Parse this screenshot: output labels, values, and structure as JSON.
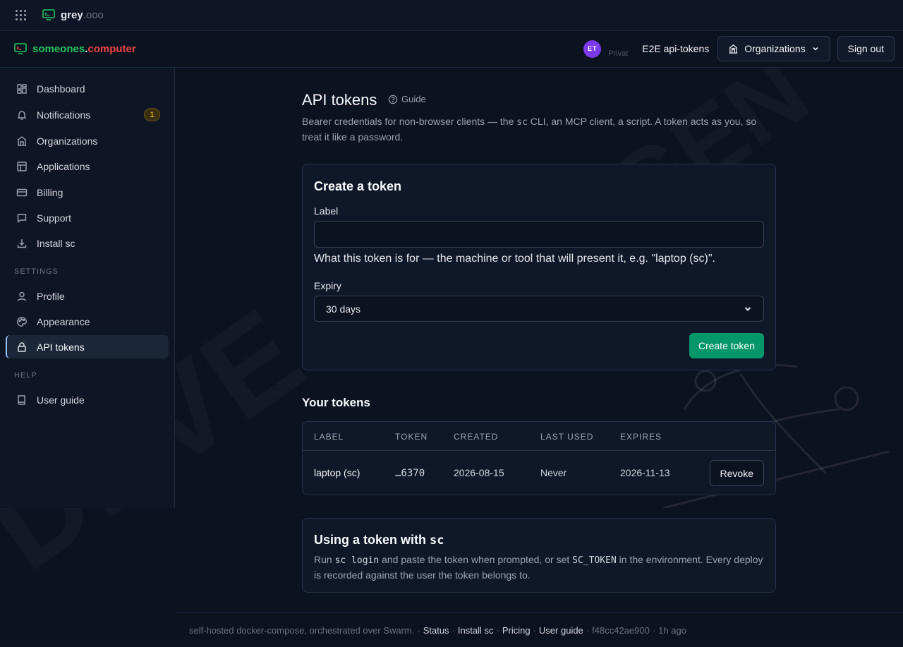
{
  "topbar": {
    "brand_main": "grey",
    "brand_suffix": ".ooo"
  },
  "header": {
    "brand_a": "someones",
    "brand_dot": ".",
    "brand_b": "computer",
    "avatar_initials": "ET",
    "avatar_sub": "Privat",
    "org_name": "E2E api-tokens",
    "organizations_label": "Organizations",
    "sign_out_label": "Sign out"
  },
  "sidebar": {
    "items": [
      {
        "label": "Dashboard",
        "icon": "dashboard-icon"
      },
      {
        "label": "Notifications",
        "icon": "bell-icon",
        "badge": "1"
      },
      {
        "label": "Organizations",
        "icon": "building-icon"
      },
      {
        "label": "Applications",
        "icon": "layout-icon"
      },
      {
        "label": "Billing",
        "icon": "credit-card-icon"
      },
      {
        "label": "Support",
        "icon": "chat-icon"
      },
      {
        "label": "Install sc",
        "icon": "download-icon"
      }
    ],
    "settings_label": "SETTINGS",
    "settings_items": [
      {
        "label": "Profile",
        "icon": "user-icon"
      },
      {
        "label": "Appearance",
        "icon": "palette-icon"
      },
      {
        "label": "API tokens",
        "icon": "lock-icon",
        "active": true
      }
    ],
    "help_label": "HELP",
    "help_items": [
      {
        "label": "User guide",
        "icon": "book-icon"
      }
    ]
  },
  "page": {
    "title": "API tokens",
    "guide_label": "Guide",
    "intro_a": "Bearer credentials for non-browser clients — the ",
    "intro_code": "sc",
    "intro_b": " CLI, an MCP client, a script. A token acts as you, so treat it like a password."
  },
  "create": {
    "title": "Create a token",
    "label_field": "Label",
    "label_value": "",
    "help": "What this token is for — the machine or tool that will present it, e.g. \"laptop (sc)\".",
    "expiry_label": "Expiry",
    "expiry_value": "30 days",
    "submit_label": "Create token"
  },
  "tokens": {
    "title": "Your tokens",
    "columns": [
      "LABEL",
      "TOKEN",
      "CREATED",
      "LAST USED",
      "EXPIRES"
    ],
    "rows": [
      {
        "label": "laptop (sc)",
        "token": "…6370",
        "created": "2026-08-15",
        "last_used": "Never",
        "expires": "2026-11-13",
        "action": "Revoke"
      }
    ]
  },
  "usage": {
    "title_a": "Using a token with ",
    "title_code": "sc",
    "text_a": "Run ",
    "text_code1": "sc login",
    "text_b": " and paste the token when prompted, or set ",
    "text_code2": "SC_TOKEN",
    "text_c": " in the environment. Every deploy is recorded against the user the token belongs to."
  },
  "footer": {
    "text": "self-hosted docker-compose, orchestrated over Swarm.",
    "links": [
      "Status",
      "Install sc",
      "Pricing",
      "User guide"
    ],
    "commit": "f48cc42ae900",
    "age": "1h ago"
  },
  "colors": {
    "accent_green": "#059669",
    "brand_green": "#22c55e",
    "brand_red": "#ef4444",
    "avatar": "#7c3aed"
  }
}
